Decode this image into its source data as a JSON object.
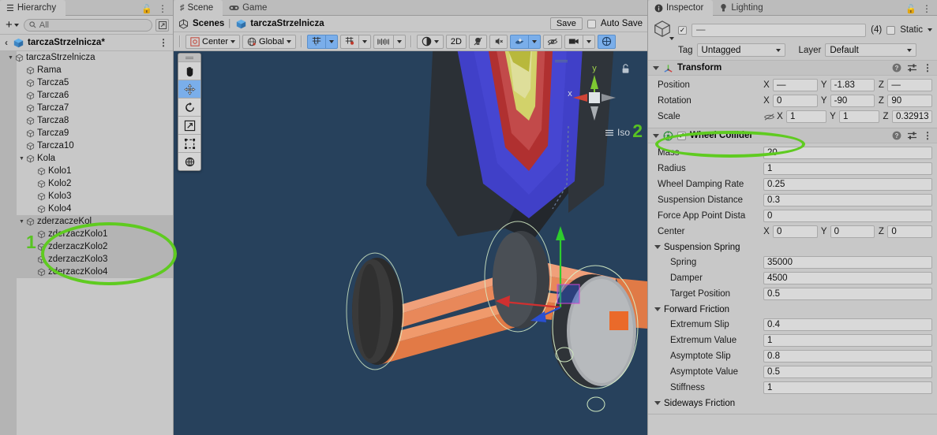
{
  "hierarchy": {
    "tab_label": "Hierarchy",
    "tab_icon": "list-icon",
    "lock_icon": "lock-icon",
    "menu_icon": "kebab-menu-icon",
    "add_label": "+",
    "search_placeholder": "All",
    "scene_name": "tarczaStrzelnicza*",
    "back_glyph": "‹",
    "tree": [
      {
        "label": "tarczaStrzelnicza",
        "depth": 1,
        "expanded": true,
        "selected": false
      },
      {
        "label": "Rama",
        "depth": 2,
        "expanded": null,
        "selected": false
      },
      {
        "label": "Tarcza5",
        "depth": 2,
        "expanded": null,
        "selected": false
      },
      {
        "label": "Tarcza6",
        "depth": 2,
        "expanded": null,
        "selected": false
      },
      {
        "label": "Tarcza7",
        "depth": 2,
        "expanded": null,
        "selected": false
      },
      {
        "label": "Tarcza8",
        "depth": 2,
        "expanded": null,
        "selected": false
      },
      {
        "label": "Tarcza9",
        "depth": 2,
        "expanded": null,
        "selected": false
      },
      {
        "label": "Tarcza10",
        "depth": 2,
        "expanded": null,
        "selected": false
      },
      {
        "label": "Kola",
        "depth": 2,
        "expanded": true,
        "selected": false
      },
      {
        "label": "Kolo1",
        "depth": 3,
        "expanded": null,
        "selected": false
      },
      {
        "label": "Kolo2",
        "depth": 3,
        "expanded": null,
        "selected": false
      },
      {
        "label": "Kolo3",
        "depth": 3,
        "expanded": null,
        "selected": false
      },
      {
        "label": "Kolo4",
        "depth": 3,
        "expanded": null,
        "selected": false
      },
      {
        "label": "zderzaczeKol",
        "depth": 2,
        "expanded": true,
        "selected": true
      },
      {
        "label": "zderzaczKolo1",
        "depth": 3,
        "expanded": null,
        "selected": true
      },
      {
        "label": "zderzaczKolo2",
        "depth": 3,
        "expanded": null,
        "selected": true
      },
      {
        "label": "zderzaczKolo3",
        "depth": 3,
        "expanded": null,
        "selected": true
      },
      {
        "label": "zderzaczKolo4",
        "depth": 3,
        "expanded": null,
        "selected": true
      }
    ]
  },
  "scene": {
    "tabs": [
      {
        "label": "Scene",
        "icon": "grid-icon",
        "active": true
      },
      {
        "label": "Game",
        "icon": "gamepad-icon",
        "active": false
      }
    ],
    "breadcrumb_root": "Scenes",
    "breadcrumb_sep": "|",
    "breadcrumb_scene": "tarczaStrzelnicza",
    "save_label": "Save",
    "auto_save_label": "Auto Save",
    "auto_save_checked": false,
    "toolbar": {
      "pivot_mode": "Center",
      "pivot_icon": "pivot-center-icon",
      "handle_space": "Global",
      "handle_icon": "globe-icon",
      "grid_icon": "grid-snap-icon",
      "grid_active": true,
      "snap_icon": "snap-increment-icon",
      "layout_icon": "layers-ruler-icon",
      "shading_icon": "shading-mode-icon",
      "view_2d_label": "2D",
      "lighting_icon": "lightbulb-off-icon",
      "audio_icon": "audio-mute-icon",
      "fx_icon": "effects-icon",
      "fx_active": true,
      "hidden_icon": "visibility-off-icon",
      "camera_icon": "camera-icon",
      "gizmos_icon": "gizmos-icon"
    },
    "tools": [
      {
        "name": "hand-tool",
        "glyph": "hand-icon",
        "active": false
      },
      {
        "name": "move-tool",
        "glyph": "move-icon",
        "active": true
      },
      {
        "name": "rotate-tool",
        "glyph": "rotate-icon",
        "active": false
      },
      {
        "name": "scale-tool",
        "glyph": "scale-icon",
        "active": false
      },
      {
        "name": "rect-tool",
        "glyph": "rect-icon",
        "active": false
      },
      {
        "name": "transform-tool",
        "glyph": "transform-icon",
        "active": false
      }
    ],
    "gizmo": {
      "projection_label": "Iso",
      "axis_x": "x",
      "axis_y": "y",
      "lock_icon": "lock-icon"
    },
    "annotations": [
      {
        "label": "1",
        "color": "#58c322"
      },
      {
        "label": "2",
        "color": "#58c322"
      }
    ],
    "highlight_color": "#5fcb20"
  },
  "inspector": {
    "tabs": [
      {
        "label": "Inspector",
        "icon": "info-icon",
        "active": true
      },
      {
        "label": "Lighting",
        "icon": "lightbulb-icon",
        "active": false
      }
    ],
    "lock_icon": "lock-icon",
    "menu_icon": "kebab-menu-icon",
    "object": {
      "enabled": true,
      "name_value": "—",
      "multi_count": "(4)",
      "static_label": "Static",
      "static_checked": false,
      "tag_label": "Tag",
      "tag_value": "Untagged",
      "layer_label": "Layer",
      "layer_value": "Default"
    },
    "components": [
      {
        "title": "Transform",
        "icon": "transform-axes-icon",
        "has_toggle": false,
        "expanded": true,
        "highlighted": false,
        "help_icon": "help-icon",
        "preset_icon": "preset-icon",
        "menu_icon": "kebab-menu-icon",
        "vector_rows": [
          {
            "label": "Position",
            "x": "—",
            "y": "-1.83",
            "z": "—",
            "mixed_icon": false
          },
          {
            "label": "Rotation",
            "x": "0",
            "y": "-90",
            "z": "90",
            "mixed_icon": false
          },
          {
            "label": "Scale",
            "x": "1",
            "y": "1",
            "z": "0.32913",
            "mixed_icon": true
          }
        ]
      },
      {
        "title": "Wheel Collider",
        "icon": "wheel-collider-icon",
        "has_toggle": true,
        "toggle_checked": true,
        "expanded": true,
        "highlighted": true,
        "help_icon": "help-icon",
        "preset_icon": "preset-icon",
        "menu_icon": "kebab-menu-icon",
        "fields": [
          {
            "label": "Mass",
            "value": "20"
          },
          {
            "label": "Radius",
            "value": "1"
          },
          {
            "label": "Wheel Damping Rate",
            "value": "0.25"
          },
          {
            "label": "Suspension Distance",
            "value": "0.3"
          },
          {
            "label": "Force App Point Dista",
            "value": "0"
          }
        ],
        "center_row": {
          "label": "Center",
          "x": "0",
          "y": "0",
          "z": "0"
        },
        "groups": [
          {
            "label": "Suspension Spring",
            "expanded": true,
            "fields": [
              {
                "label": "Spring",
                "value": "35000"
              },
              {
                "label": "Damper",
                "value": "4500"
              },
              {
                "label": "Target Position",
                "value": "0.5"
              }
            ]
          },
          {
            "label": "Forward Friction",
            "expanded": true,
            "fields": [
              {
                "label": "Extremum Slip",
                "value": "0.4"
              },
              {
                "label": "Extremum Value",
                "value": "1"
              },
              {
                "label": "Asymptote Slip",
                "value": "0.8"
              },
              {
                "label": "Asymptote Value",
                "value": "0.5"
              },
              {
                "label": "Stiffness",
                "value": "1"
              }
            ]
          },
          {
            "label": "Sideways Friction",
            "expanded": true,
            "fields": []
          }
        ]
      }
    ]
  }
}
